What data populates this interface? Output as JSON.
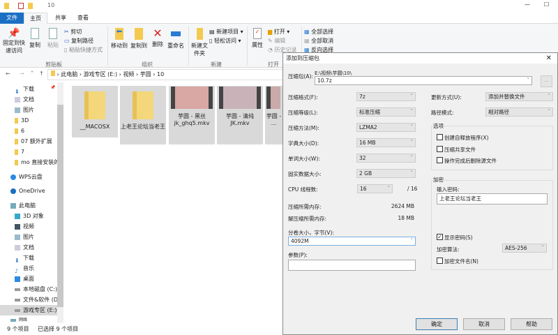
{
  "window": {
    "title": "10"
  },
  "ribbon": {
    "tabs": [
      "文件",
      "主页",
      "共享",
      "查看"
    ],
    "clipboard": {
      "pin": "固定到快速访问",
      "copy": "复制",
      "paste": "粘贴",
      "cut": "剪切",
      "copy_path": "复制路径",
      "paste_shortcut": "粘贴快捷方式",
      "group": "剪贴板"
    },
    "organize": {
      "move_to": "移动到",
      "copy_to": "复制到",
      "delete": "删除",
      "rename": "重命名",
      "group": "组织"
    },
    "new": {
      "new_folder": "新建文件夹",
      "new_item": "新建项目",
      "easy_access": "轻松访问",
      "group": "新建"
    },
    "open": {
      "properties": "属性",
      "open": "打开",
      "edit": "编辑",
      "history": "历史记录",
      "group": "打开"
    },
    "select": {
      "select_all": "全部选择",
      "select_none": "全部取消",
      "invert": "反向选择"
    }
  },
  "address": {
    "crumbs": [
      "此电脑",
      "游戏专区 (E:)",
      "视频",
      "芋圆",
      "10"
    ]
  },
  "nav": {
    "quick": [
      "下载",
      "文档",
      "图片",
      "3D",
      "6",
      "07 额外扩展",
      "7",
      "mo 直接安装的"
    ],
    "wps": "WPS云盘",
    "onedrive": "OneDrive",
    "pc": "此电脑",
    "pc_items": [
      "3D 对象",
      "视频",
      "图片",
      "文档",
      "下载",
      "音乐",
      "桌面",
      "本地磁盘 (C:)",
      "文件&软件 (D",
      "游戏专区 (E:)"
    ],
    "network": "网络"
  },
  "files": [
    "__MACOSX",
    "上老王论坛当老王",
    "芋圆 - 黑丝jk_ghq5.mkv",
    "芋圆 - 清纯JK.mkv",
    "芋圆 - ..."
  ],
  "status": {
    "count": "9 个项目",
    "selected": "已选择 9 个项目"
  },
  "dialog": {
    "title": "添加到压缩包",
    "archive_label": "压缩包(A):",
    "archive_path": "E:\\视频\\芋圆\\10\\",
    "archive_name": "10.7z",
    "browse": "...",
    "format_label": "压缩格式(F):",
    "format": "7z",
    "level_label": "压缩等级(L):",
    "level": "标准压缩",
    "method_label": "压缩方法(M):",
    "method": "LZMA2",
    "dict_label": "字典大小(D):",
    "dict": "16 MB",
    "word_label": "单词大小(W):",
    "word": "32",
    "solid_label": "固实数据大小:",
    "solid": "2 GB",
    "cpu_label": "CPU 线程数:",
    "cpu": "16",
    "cpu_max": "/ 16",
    "mem_comp_label": "压缩所需内存:",
    "mem_comp": "2624 MB",
    "mem_decomp_label": "解压缩所需内存:",
    "mem_decomp": "18 MB",
    "split_label": "分卷大小，字节(V):",
    "split": "4092M",
    "params_label": "参数(P):",
    "params": "",
    "update_label": "更新方式(U):",
    "update": "添加并替换文件",
    "path_label": "路径模式:",
    "path_mode": "相对路径",
    "options_label": "选项",
    "opt_sfx": "创建自释放程序(X)",
    "opt_shared": "压缩共享文件",
    "opt_delete": "操作完成后删除源文件",
    "enc_label": "加密",
    "pwd_label": "输入密码:",
    "password": "上老王论坛当老王",
    "show_pwd": "显示密码(S)",
    "show_pwd_checked": true,
    "enc_method_label": "加密算法:",
    "enc_method": "AES-256",
    "enc_names": "加密文件名(N)",
    "ok": "确定",
    "cancel": "取消",
    "help": "帮助"
  }
}
